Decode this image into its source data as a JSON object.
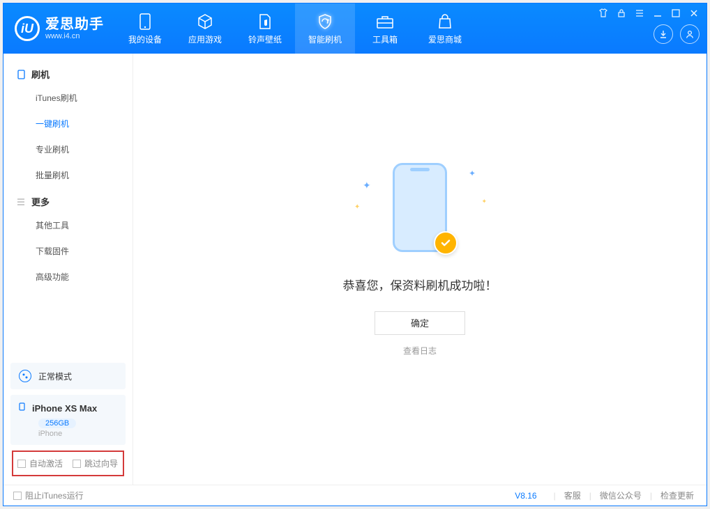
{
  "app": {
    "name_cn": "爱思助手",
    "name_en": "www.i4.cn",
    "logo_letter": "iU"
  },
  "nav": [
    {
      "key": "device",
      "label": "我的设备"
    },
    {
      "key": "apps",
      "label": "应用游戏"
    },
    {
      "key": "media",
      "label": "铃声壁纸"
    },
    {
      "key": "flash",
      "label": "智能刷机"
    },
    {
      "key": "tools",
      "label": "工具箱"
    },
    {
      "key": "store",
      "label": "爱思商城"
    }
  ],
  "sidebar": {
    "group1_title": "刷机",
    "group1": [
      {
        "label": "iTunes刷机"
      },
      {
        "label": "一键刷机"
      },
      {
        "label": "专业刷机"
      },
      {
        "label": "批量刷机"
      }
    ],
    "group2_title": "更多",
    "group2": [
      {
        "label": "其他工具"
      },
      {
        "label": "下载固件"
      },
      {
        "label": "高级功能"
      }
    ],
    "mode_label": "正常模式",
    "device": {
      "name": "iPhone XS Max",
      "capacity": "256GB",
      "type": "iPhone"
    },
    "checks": {
      "auto_activate": "自动激活",
      "skip_guide": "跳过向导"
    }
  },
  "main": {
    "success_message": "恭喜您，保资料刷机成功啦！",
    "ok_button": "确定",
    "view_log": "查看日志"
  },
  "footer": {
    "block_itunes": "阻止iTunes运行",
    "version": "V8.16",
    "links": {
      "support": "客服",
      "wechat": "微信公众号",
      "update": "检查更新"
    }
  }
}
